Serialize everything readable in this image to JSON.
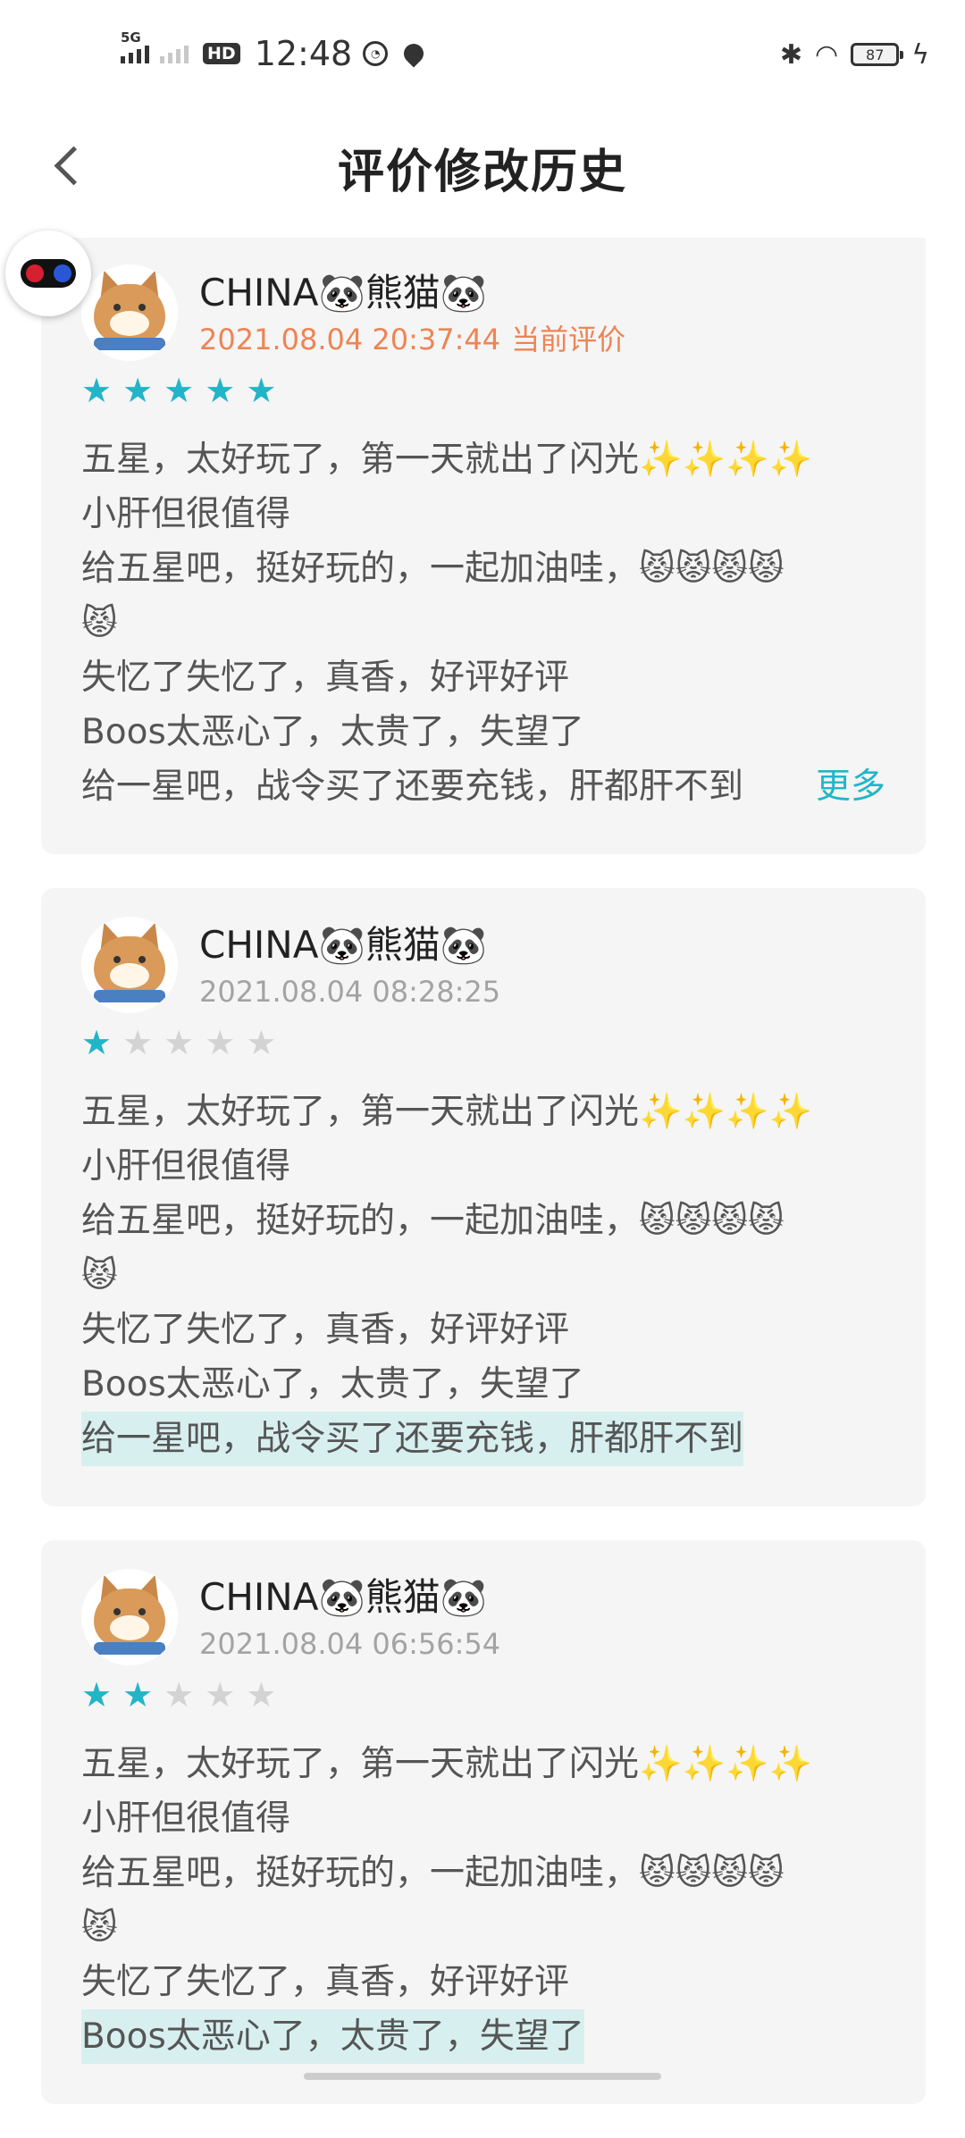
{
  "status_bar": {
    "network": "5G",
    "hd": "HD",
    "time": "12:48",
    "battery": "87"
  },
  "header": {
    "title": "评价修改历史"
  },
  "reviews": [
    {
      "username": "CHINA🐼熊猫🐼",
      "timestamp": "2021.08.04 20:37:44",
      "current_label": "当前评价",
      "rating": 5,
      "lines": [
        "五星，太好玩了，第一天就出了闪光✨✨✨✨",
        "小肝但很值得",
        "给五星吧，挺好玩的，一起加油哇，😾😾😾😾",
        "😾",
        "失忆了失忆了，真香，好评好评",
        "Boos太恶心了，太贵了，失望了",
        "给一星吧，战令买了还要充钱，肝都肝不到"
      ],
      "more_label": "更多"
    },
    {
      "username": "CHINA🐼熊猫🐼",
      "timestamp": "2021.08.04 08:28:25",
      "rating": 1,
      "lines": [
        "五星，太好玩了，第一天就出了闪光✨✨✨✨",
        "小肝但很值得",
        "给五星吧，挺好玩的，一起加油哇，😾😾😾😾",
        "😾",
        "失忆了失忆了，真香，好评好评",
        "Boos太恶心了，太贵了，失望了",
        "给一星吧，战令买了还要充钱，肝都肝不到"
      ]
    },
    {
      "username": "CHINA🐼熊猫🐼",
      "timestamp": "2021.08.04 06:56:54",
      "rating": 2,
      "lines": [
        "五星，太好玩了，第一天就出了闪光✨✨✨✨",
        "小肝但很值得",
        "给五星吧，挺好玩的，一起加油哇，😾😾😾😾",
        "😾",
        "失忆了失忆了，真香，好评好评",
        "Boos太恶心了，太贵了，失望了"
      ]
    }
  ],
  "colors": {
    "accent": "#22b5c8",
    "current_timestamp": "#ee8454",
    "highlight_bg": "#d8efef",
    "card_bg": "#f5f5f5"
  }
}
